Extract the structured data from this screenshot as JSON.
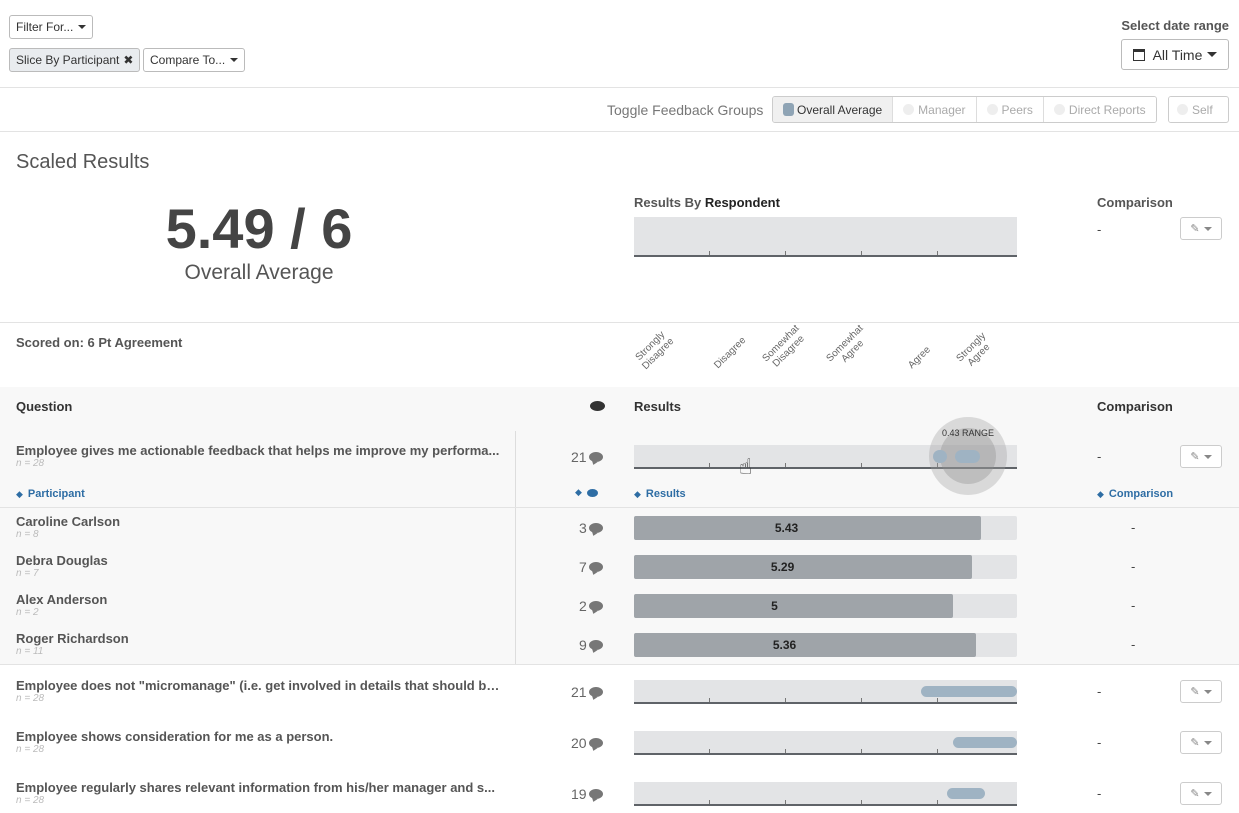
{
  "filters": {
    "filter_for": "Filter For...",
    "slice_by": "Slice By Participant",
    "compare_to": "Compare To..."
  },
  "date_range": {
    "label": "Select date range",
    "value": "All Time"
  },
  "toggle_groups": {
    "label": "Toggle Feedback Groups",
    "items": [
      "Overall Average",
      "Manager",
      "Peers",
      "Direct Reports"
    ],
    "self": "Self"
  },
  "scaled": {
    "title": "Scaled Results",
    "score": "5.49 / 6",
    "score_label": "Overall Average",
    "results_by": "Results By",
    "results_by_bold": "Respondent",
    "comparison_label": "Comparison",
    "comparison_value": "-"
  },
  "scored_on": "Scored on: 6 Pt Agreement",
  "scale_labels": [
    "Strongly\nDisagree",
    "Disagree",
    "Somewhat\nDisagree",
    "Somewhat\nAgree",
    "Agree",
    "Strongly\nAgree"
  ],
  "table_headers": {
    "question": "Question",
    "results": "Results",
    "comparison": "Comparison"
  },
  "expanded_question": {
    "text": "Employee gives me actionable feedback that helps me improve my performa...",
    "n": "n = 28",
    "count": "21",
    "range_label": "0.43 RANGE",
    "comparison": "-",
    "range_min": 5.0,
    "range_max": 5.43
  },
  "sub_headers": {
    "participant": "Participant",
    "results": "Results",
    "comparison": "Comparison"
  },
  "participants": [
    {
      "name": "Caroline Carlson",
      "n": "n = 8",
      "count": "3",
      "value": "5.43",
      "comparison": "-"
    },
    {
      "name": "Debra Douglas",
      "n": "n = 7",
      "count": "7",
      "value": "5.29",
      "comparison": "-"
    },
    {
      "name": "Alex Anderson",
      "n": "n = 2",
      "count": "2",
      "value": "5",
      "comparison": "-"
    },
    {
      "name": "Roger Richardson",
      "n": "n = 11",
      "count": "9",
      "value": "5.36",
      "comparison": "-"
    }
  ],
  "questions": [
    {
      "text": "Employee does not \"micromanage\" (i.e. get involved in details that should be ...",
      "n": "n = 28",
      "count": "21",
      "comparison": "-",
      "range_min": 4.5,
      "range_max": 6.0
    },
    {
      "text": "Employee shows consideration for me as a person.",
      "n": "n = 28",
      "count": "20",
      "comparison": "-",
      "range_min": 5.0,
      "range_max": 6.0
    },
    {
      "text": "Employee regularly shares relevant information from his/her manager and s...",
      "n": "n = 28",
      "count": "19",
      "comparison": "-",
      "range_min": 4.9,
      "range_max": 5.5
    }
  ],
  "colors": {
    "accent_blue": "#2e6da4",
    "range_bar": "#9fb3c3",
    "participant_bar": "#9fa4a9",
    "track": "#e3e4e6"
  }
}
